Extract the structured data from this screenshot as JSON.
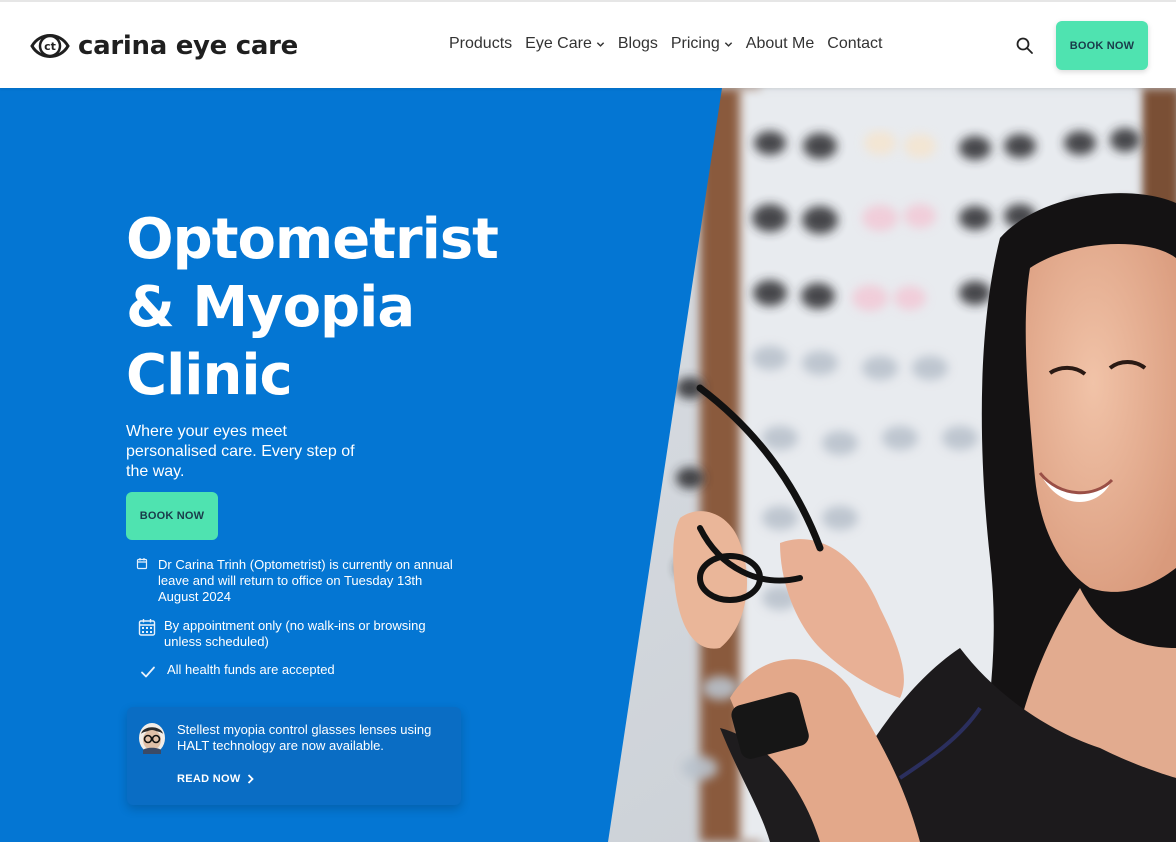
{
  "brand": {
    "logo_mark_text": "ct",
    "name": "carina eye care"
  },
  "nav": {
    "items": [
      {
        "label": "Products",
        "has_dropdown": false
      },
      {
        "label": "Eye Care",
        "has_dropdown": true
      },
      {
        "label": "Blogs",
        "has_dropdown": false
      },
      {
        "label": "Pricing",
        "has_dropdown": true
      },
      {
        "label": "About Me",
        "has_dropdown": false
      },
      {
        "label": "Contact",
        "has_dropdown": false
      }
    ],
    "search_icon": "search-icon",
    "book_label": "BOOK NOW"
  },
  "hero": {
    "title_line1": "Optometrist",
    "title_line2": "& Myopia",
    "title_line3": "Clinic",
    "subtitle": "Where your eyes meet personalised care. Every step of the way.",
    "book_label": "BOOK NOW",
    "notices": [
      {
        "icon": "calendar-icon",
        "text": "Dr Carina Trinh (Optometrist) is currently on annual leave and will return to office on Tuesday 13th August 2024"
      },
      {
        "icon": "calendar-grid-icon",
        "text": "By appointment only (no walk-ins or browsing unless scheduled)"
      },
      {
        "icon": "checkmark-icon",
        "text": "All health funds are accepted"
      }
    ],
    "promo": {
      "text": "Stellest myopia control glasses lenses using HALT technology are now available.",
      "link_label": "READ NOW"
    }
  },
  "colors": {
    "hero_blue": "#0476d3",
    "accent_green": "#4fe3b0",
    "button_text": "#1a3a4a",
    "promo_bg": "#0a6dc4"
  }
}
